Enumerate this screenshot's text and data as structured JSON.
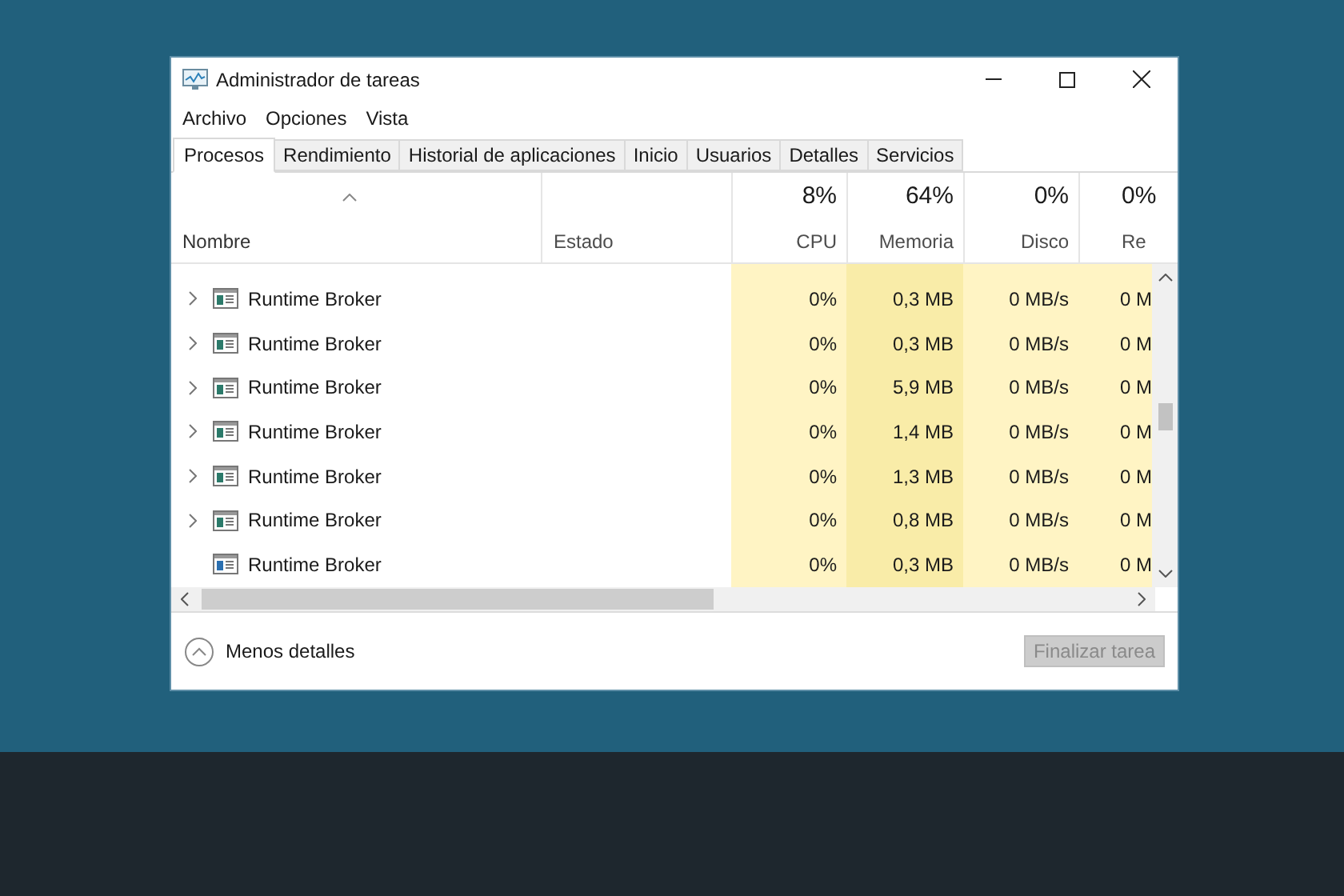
{
  "window": {
    "title": "Administrador de tareas"
  },
  "menu": [
    "Archivo",
    "Opciones",
    "Vista"
  ],
  "tabs": [
    {
      "label": "Procesos",
      "selected": true
    },
    {
      "label": "Rendimiento",
      "selected": false
    },
    {
      "label": "Historial de aplicaciones",
      "selected": false
    },
    {
      "label": "Inicio",
      "selected": false
    },
    {
      "label": "Usuarios",
      "selected": false
    },
    {
      "label": "Detalles",
      "selected": false
    },
    {
      "label": "Servicios",
      "selected": false
    }
  ],
  "table": {
    "columns": [
      {
        "label": "Nombre",
        "sorted": true
      },
      {
        "label": "Estado",
        "sorted": false
      },
      {
        "label": "CPU",
        "percent": "8%",
        "sorted": false
      },
      {
        "label": "Memoria",
        "percent": "64%",
        "sorted": false
      },
      {
        "label": "Disco",
        "percent": "0%",
        "sorted": false
      },
      {
        "label": "Re",
        "percent": "0%",
        "sorted": false
      }
    ],
    "rows": [
      {
        "name": "Runtime Broker",
        "expandable": true,
        "cpu": "0%",
        "memory": "0,3 MB",
        "disk": "0 MB/s",
        "network": "0 M"
      },
      {
        "name": "Runtime Broker",
        "expandable": true,
        "cpu": "0%",
        "memory": "0,3 MB",
        "disk": "0 MB/s",
        "network": "0 M"
      },
      {
        "name": "Runtime Broker",
        "expandable": true,
        "cpu": "0%",
        "memory": "5,9 MB",
        "disk": "0 MB/s",
        "network": "0 M"
      },
      {
        "name": "Runtime Broker",
        "expandable": true,
        "cpu": "0%",
        "memory": "1,4 MB",
        "disk": "0 MB/s",
        "network": "0 M"
      },
      {
        "name": "Runtime Broker",
        "expandable": true,
        "cpu": "0%",
        "memory": "1,3 MB",
        "disk": "0 MB/s",
        "network": "0 M"
      },
      {
        "name": "Runtime Broker",
        "expandable": true,
        "cpu": "0%",
        "memory": "0,8 MB",
        "disk": "0 MB/s",
        "network": "0 M"
      },
      {
        "name": "Runtime Broker",
        "expandable": false,
        "cpu": "0%",
        "memory": "0,3 MB",
        "disk": "0 MB/s",
        "network": "0 M"
      }
    ]
  },
  "footer": {
    "toggle": "Menos detalles",
    "end_task": {
      "label": "Finalizar tarea",
      "disabled": true
    }
  }
}
